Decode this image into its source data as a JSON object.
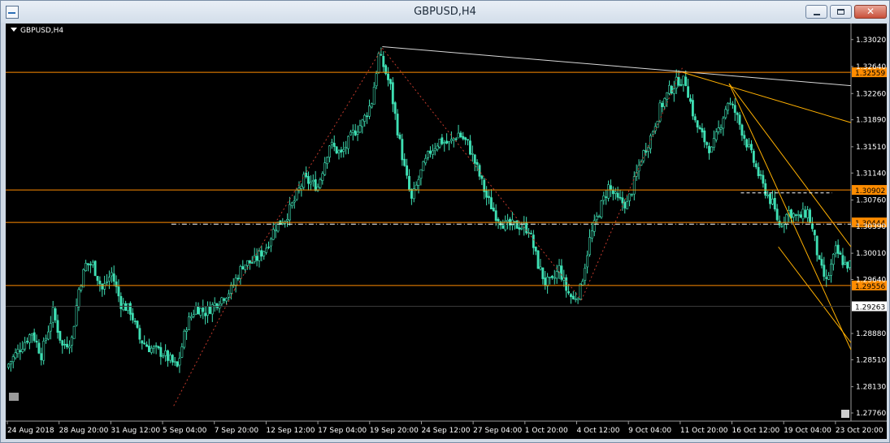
{
  "window": {
    "title": "GBPUSD,H4",
    "symbol_label": "GBPUSD,H4"
  },
  "colors": {
    "background": "#000000",
    "candle": "#3fe0b4",
    "level_line": "#ff8c00",
    "trend_line": "#d8d8d8",
    "channel_line": "#ffb000",
    "text": "#ffffff"
  },
  "chart_data": {
    "type": "candlestick",
    "title": "GBPUSD,H4",
    "y_axis_ticks": [
      "1.33020",
      "1.32640",
      "1.32260",
      "1.31890",
      "1.31510",
      "1.31140",
      "1.30760",
      "1.30390",
      "1.30010",
      "1.29640",
      "1.28880",
      "1.28510",
      "1.28130",
      "1.27760"
    ],
    "ylim": [
      1.276,
      1.332
    ],
    "x_axis_labels": [
      "24 Aug 2018",
      "28 Aug 20:00",
      "31 Aug 12:00",
      "5 Sep 04:00",
      "7 Sep 20:00",
      "12 Sep 12:00",
      "17 Sep 04:00",
      "19 Sep 20:00",
      "24 Sep 12:00",
      "27 Sep 04:00",
      "1 Oct 20:00",
      "4 Oct 12:00",
      "9 Oct 04:00",
      "11 Oct 20:00",
      "16 Oct 12:00",
      "19 Oct 04:00",
      "23 Oct 20:00"
    ],
    "horizontal_levels": [
      {
        "value": "1.32559",
        "color": "#ff8c00"
      },
      {
        "value": "1.30902",
        "color": "#ff8c00"
      },
      {
        "value": "1.30444",
        "color": "#ff8c00"
      },
      {
        "value": "1.29556",
        "color": "#ff8c00"
      }
    ],
    "current_price": "1.29263",
    "close_path": [
      [
        0,
        1.2845
      ],
      [
        6,
        1.2872
      ],
      [
        10,
        1.289
      ],
      [
        14,
        1.2858
      ],
      [
        19,
        1.2918
      ],
      [
        23,
        1.287
      ],
      [
        27,
        1.288
      ],
      [
        30,
        1.295
      ],
      [
        33,
        1.2985
      ],
      [
        36,
        1.2985
      ],
      [
        40,
        1.295
      ],
      [
        44,
        1.2973
      ],
      [
        48,
        1.293
      ],
      [
        52,
        1.292
      ],
      [
        56,
        1.288
      ],
      [
        60,
        1.2868
      ],
      [
        66,
        1.286
      ],
      [
        72,
        1.284
      ],
      [
        76,
        1.29
      ],
      [
        80,
        1.2925
      ],
      [
        84,
        1.2918
      ],
      [
        90,
        1.2935
      ],
      [
        95,
        1.295
      ],
      [
        100,
        1.2985
      ],
      [
        105,
        1.299
      ],
      [
        110,
        1.301
      ],
      [
        114,
        1.304
      ],
      [
        118,
        1.305
      ],
      [
        122,
        1.3075
      ],
      [
        126,
        1.3105
      ],
      [
        132,
        1.3095
      ],
      [
        137,
        1.3155
      ],
      [
        142,
        1.314
      ],
      [
        147,
        1.317
      ],
      [
        151,
        1.3185
      ],
      [
        155,
        1.3215
      ],
      [
        158,
        1.328
      ],
      [
        160,
        1.3265
      ],
      [
        163,
        1.3235
      ],
      [
        166,
        1.3175
      ],
      [
        169,
        1.312
      ],
      [
        172,
        1.3075
      ],
      [
        176,
        1.3115
      ],
      [
        180,
        1.3145
      ],
      [
        184,
        1.316
      ],
      [
        188,
        1.3155
      ],
      [
        192,
        1.317
      ],
      [
        196,
        1.3155
      ],
      [
        200,
        1.312
      ],
      [
        204,
        1.308
      ],
      [
        208,
        1.3055
      ],
      [
        212,
        1.304
      ],
      [
        218,
        1.304
      ],
      [
        222,
        1.3035
      ],
      [
        226,
        1.2985
      ],
      [
        229,
        1.296
      ],
      [
        232,
        1.296
      ],
      [
        235,
        1.298
      ],
      [
        238,
        1.295
      ],
      [
        241,
        1.2935
      ],
      [
        244,
        1.295
      ],
      [
        248,
        1.302
      ],
      [
        252,
        1.306
      ],
      [
        256,
        1.3095
      ],
      [
        260,
        1.3075
      ],
      [
        264,
        1.307
      ],
      [
        266,
        1.309
      ],
      [
        270,
        1.3135
      ],
      [
        274,
        1.3165
      ],
      [
        278,
        1.3205
      ],
      [
        282,
        1.323
      ],
      [
        286,
        1.3245
      ],
      [
        289,
        1.3242
      ],
      [
        293,
        1.3185
      ],
      [
        297,
        1.316
      ],
      [
        300,
        1.3145
      ],
      [
        303,
        1.3175
      ],
      [
        307,
        1.3215
      ],
      [
        310,
        1.32
      ],
      [
        314,
        1.3165
      ],
      [
        318,
        1.313
      ],
      [
        322,
        1.3095
      ],
      [
        326,
        1.307
      ],
      [
        329,
        1.304
      ],
      [
        333,
        1.306
      ],
      [
        337,
        1.305
      ],
      [
        341,
        1.306
      ],
      [
        344,
        1.302
      ],
      [
        346,
        1.2985
      ],
      [
        349,
        1.296
      ],
      [
        353,
        1.3005
      ],
      [
        357,
        1.2985
      ]
    ]
  }
}
